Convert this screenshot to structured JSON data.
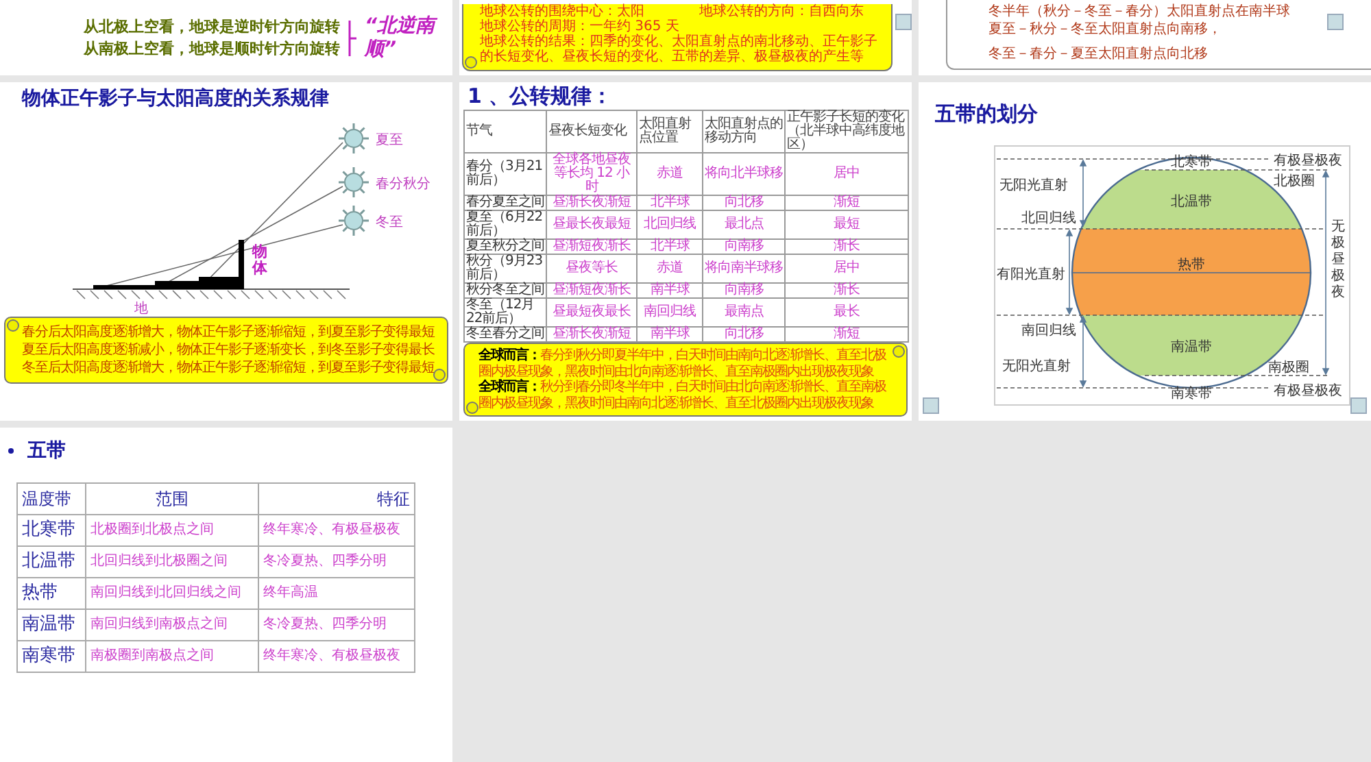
{
  "top_row": [
    {
      "kind": "rotation",
      "lines": [
        "从北极上空看，地球是逆时针方向旋转",
        "从南极上空看，地球是顺时针方向旋转"
      ],
      "motto": "“北逆南顺”"
    },
    {
      "kind": "scroll",
      "lines": [
        [
          "地球公转的围绕中心：太阳",
          "地球公转的方向：自西向东"
        ],
        [
          "地球公转的周期：一年约 365 天"
        ],
        [
          "地球公转的结果：四季的变化、太阳直射点的南北移动、正午影子的长短变化、昼夜长短的变化、五带的差异、极昼极夜的产生等"
        ]
      ]
    },
    {
      "kind": "notes",
      "lines": [
        "冬半年（秋分－冬至－春分）太阳直射点在南半球",
        "夏至－秋分－冬至太阳直射点向南移，",
        "冬至－春分－夏至太阳直射点向北移"
      ]
    }
  ],
  "shadow_slide": {
    "title": "物体正午影子与太阳高度的关系规律",
    "sun_labels": [
      "夏至",
      "春分秋分",
      "冬至"
    ],
    "object_label": "物体",
    "ground_label": "地",
    "notes": [
      "春分后太阳高度逐渐增大，物体正午影子逐渐缩短，到夏至影子变得最短",
      "夏至后太阳高度逐渐减小，物体正午影子逐渐变长，到冬至影子变得最长",
      "冬至后太阳高度逐渐增大，物体正午影子逐渐缩短，到夏至影子变得最短"
    ]
  },
  "revolution_slide": {
    "title": "1 、公转规律：",
    "columns": [
      "节气",
      "昼夜长短变化",
      "太阳直射点位置",
      "太阳直射点的移动方向",
      "正午影子长短的变化（北半球中高纬度地区）"
    ],
    "rows": [
      [
        "春分（3月21前后）",
        "全球各地昼夜等长均 12 小时",
        "赤道",
        "将向北半球移",
        "居中"
      ],
      [
        "春分夏至之间",
        "昼渐长夜渐短",
        "北半球",
        "向北移",
        "渐短"
      ],
      [
        "夏至（6月22前后）",
        "昼最长夜最短",
        "北回归线",
        "最北点",
        "最短"
      ],
      [
        "夏至秋分之间",
        "昼渐短夜渐长",
        "北半球",
        "向南移",
        "渐长"
      ],
      [
        "秋分（9月23前后）",
        "昼夜等长",
        "赤道",
        "将向南半球移",
        "居中"
      ],
      [
        "秋分冬至之间",
        "昼渐短夜渐长",
        "南半球",
        "向南移",
        "渐长"
      ],
      [
        "冬至（12月22前后）",
        "昼最短夜最长",
        "南回归线",
        "最南点",
        "最长"
      ],
      [
        "冬至春分之间",
        "昼渐长夜渐短",
        "南半球",
        "向北移",
        "渐短"
      ]
    ],
    "notes": [
      "**全球而言：**春分到秋分即夏半年中，白天时间由南向北逐渐增长、直至北极圈内极昼现象，黑夜时间由北向南逐渐增长、直至南极圈内出现极夜现象",
      "**全球而言：**秋分到春分即冬半年中，白天时间由北向南逐渐增长、直至南极圈内极昼现象，黑夜时间由南向北逐渐增长、直至北极圈内出现极夜现象"
    ]
  },
  "zones_slide": {
    "title": "五带的划分",
    "zones": [
      "北寒带",
      "北温带",
      "热带",
      "南温带",
      "南寒带"
    ],
    "left_labels": [
      "无阳光直射",
      "北回归线",
      "有阳光直射",
      "南回归线",
      "无阳光直射"
    ],
    "right_labels": [
      "有极昼极夜",
      "北极圈",
      "南极圈",
      "有极昼极夜"
    ],
    "vertical_label": "无极昼极夜"
  },
  "belts_slide": {
    "title": "五带",
    "columns": [
      "温度带",
      "范围",
      "特征"
    ],
    "rows": [
      [
        "北寒带",
        "北极圈到北极点之间",
        "终年寒冷、有极昼极夜"
      ],
      [
        "北温带",
        "北回归线到北极圈之间",
        "冬冷夏热、四季分明"
      ],
      [
        "热带",
        "南回归线到北回归线之间",
        "终年高温"
      ],
      [
        "南温带",
        "南回归线到南极点之间",
        "冬冷夏热、四季分明"
      ],
      [
        "南寒带",
        "南极圈到南极点之间",
        "终年寒冷、有极昼极夜"
      ]
    ]
  }
}
